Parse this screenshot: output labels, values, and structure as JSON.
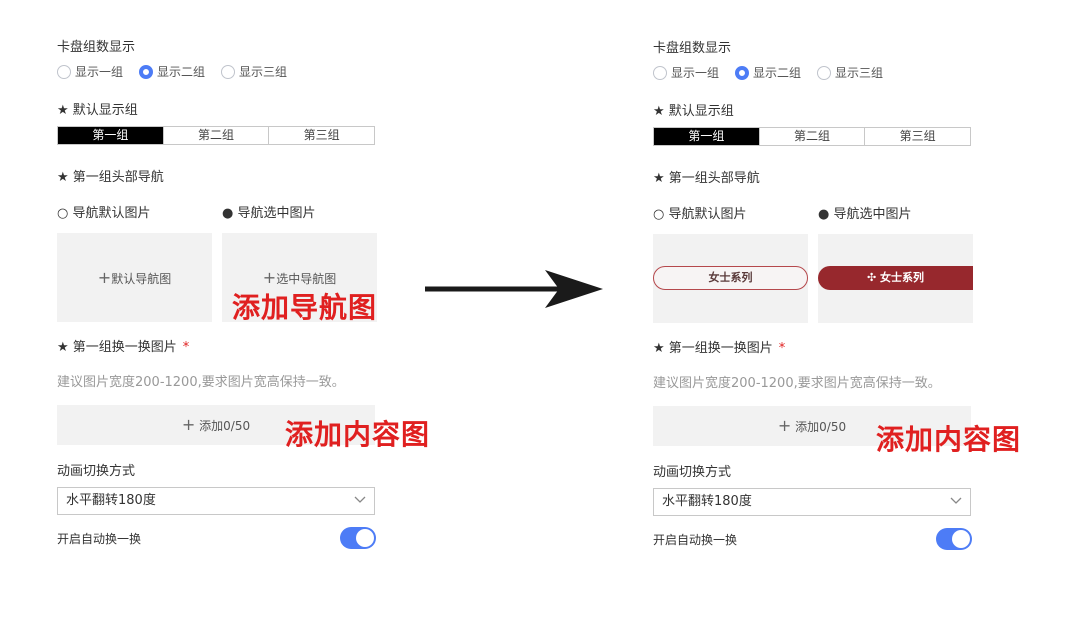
{
  "left": {
    "card_group_title": "卡盘组数显示",
    "radios": [
      "显示一组",
      "显示二组",
      "显示三组"
    ],
    "radio_selected": 1,
    "default_group_title": "★ 默认显示组",
    "segments": [
      "第一组",
      "第二组",
      "第三组"
    ],
    "segment_active": 0,
    "header_nav_title": "★ 第一组头部导航",
    "nav_default_label": "○ 导航默认图片",
    "nav_selected_label": "● 导航选中图片",
    "nav_default_upload": "默认导航图",
    "nav_selected_upload": "选中导航图",
    "swap_title": "★ 第一组换一换图片",
    "required_mark": "*",
    "hint": "建议图片宽度200-1200,要求图片宽高保持一致。",
    "upload_label": "添加0/50",
    "animation_title": "动画切换方式",
    "animation_value": "水平翻转180度",
    "auto_label": "开启自动换一换",
    "auto_on": true
  },
  "right": {
    "card_group_title": "卡盘组数显示",
    "radios": [
      "显示一组",
      "显示二组",
      "显示三组"
    ],
    "radio_selected": 1,
    "default_group_title": "★ 默认显示组",
    "segments": [
      "第一组",
      "第二组",
      "第三组"
    ],
    "segment_active": 0,
    "header_nav_title": "★ 第一组头部导航",
    "nav_default_label": "○ 导航默认图片",
    "nav_selected_label": "● 导航选中图片",
    "nav_default_pill": "女士系列",
    "nav_selected_pill": "✣ 女士系列",
    "swap_title": "★ 第一组换一换图片",
    "required_mark": "*",
    "hint": "建议图片宽度200-1200,要求图片宽高保持一致。",
    "upload_label": "添加0/50",
    "animation_title": "动画切换方式",
    "animation_value": "水平翻转180度",
    "auto_label": "开启自动换一换",
    "auto_on": true
  },
  "annotations": {
    "add_nav_image": "添加导航图",
    "add_content_image_left": "添加内容图",
    "add_content_image_right": "添加内容图"
  },
  "colors": {
    "accent": "#4d7cf6",
    "annotation_red": "#e02020",
    "pill_red": "#97282d"
  },
  "icons": [
    "plus-icon",
    "chevron-down-icon",
    "arrow-right-icon"
  ]
}
